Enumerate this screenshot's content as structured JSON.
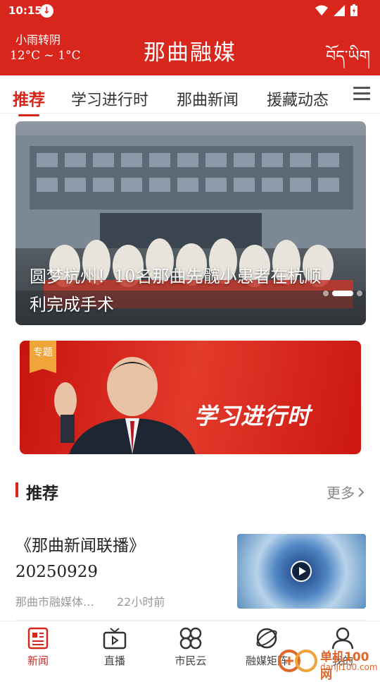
{
  "status_bar": {
    "time": "10:15"
  },
  "header": {
    "weather_desc": "小雨转阴",
    "weather_temp": "12°C ~ 1°C",
    "title": "那曲融媒",
    "tibetan_label": "བོད་ཡིག"
  },
  "tabs": [
    {
      "label": "推荐",
      "active": true
    },
    {
      "label": "学习进行时",
      "active": false
    },
    {
      "label": "那曲新闻",
      "active": false
    },
    {
      "label": "援藏动态",
      "active": false
    }
  ],
  "hero": {
    "caption": "圆梦杭州！10名那曲先髋小患者在杭顺利完成手术",
    "slide_count": 3,
    "active_slide": 2
  },
  "banner": {
    "badge": "专题",
    "title": "学习进行时"
  },
  "section": {
    "title": "推荐",
    "more_label": "更多"
  },
  "news": [
    {
      "title": "《那曲新闻联播》20250929",
      "source": "那曲市融媒体…",
      "time": "22小时前"
    }
  ],
  "bottom_nav": [
    {
      "label": "新闻",
      "icon": "news-icon",
      "active": true
    },
    {
      "label": "直播",
      "icon": "tv-icon",
      "active": false
    },
    {
      "label": "市民云",
      "icon": "grid-icon",
      "active": false
    },
    {
      "label": "融媒矩阵",
      "icon": "orbit-icon",
      "active": false
    },
    {
      "label": "我的",
      "icon": "user-icon",
      "active": false
    }
  ],
  "watermark": {
    "text": "单机100网",
    "url": "danji100.com"
  },
  "colors": {
    "brand_red": "#d8261c",
    "badge_orange": "#f0a43a"
  }
}
